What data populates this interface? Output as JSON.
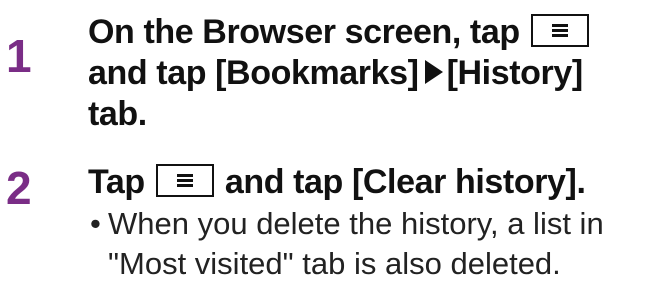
{
  "steps": [
    {
      "number": "1",
      "line1_pre": "On the Browser screen, tap",
      "line2_pre": "and tap [Bookmarks]",
      "line2_post": "[History]",
      "line3": "tab."
    },
    {
      "number": "2",
      "line1_pre": "Tap",
      "line1_post": "and tap [Clear history].",
      "note_bullet": "•",
      "note_line1": "When you delete the history, a list in",
      "note_line2": "\"Most visited\" tab is also deleted."
    }
  ],
  "colors": {
    "step_number": "#7a2d86",
    "text": "#111111"
  },
  "icons": {
    "menu_key": "menu-key-icon",
    "arrow": "right-triangle-arrow-icon"
  }
}
